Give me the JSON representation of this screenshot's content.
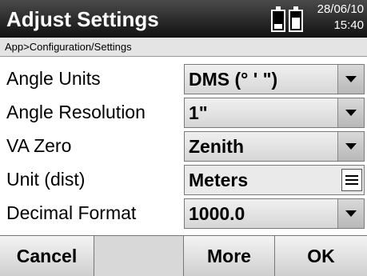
{
  "header": {
    "title": "Adjust Settings",
    "date": "28/06/10",
    "time": "15:40",
    "battery_icons": [
      "battery-icon",
      "battery-icon"
    ]
  },
  "breadcrumb": "App>Configuration/Settings",
  "settings": [
    {
      "label": "Angle Units",
      "value": "DMS (° ' \")",
      "control": "dropdown"
    },
    {
      "label": "Angle Resolution",
      "value": "1\"",
      "control": "dropdown"
    },
    {
      "label": "VA Zero",
      "value": "Zenith",
      "control": "dropdown"
    },
    {
      "label": "Unit (dist)",
      "value": "Meters",
      "control": "list"
    },
    {
      "label": "Decimal Format",
      "value": "1000.0",
      "control": "dropdown"
    }
  ],
  "footer": {
    "cancel": "Cancel",
    "blank": "",
    "more": "More",
    "ok": "OK"
  },
  "colors": {
    "titlebar": "#111111",
    "control_bg": "#eaeaea"
  }
}
